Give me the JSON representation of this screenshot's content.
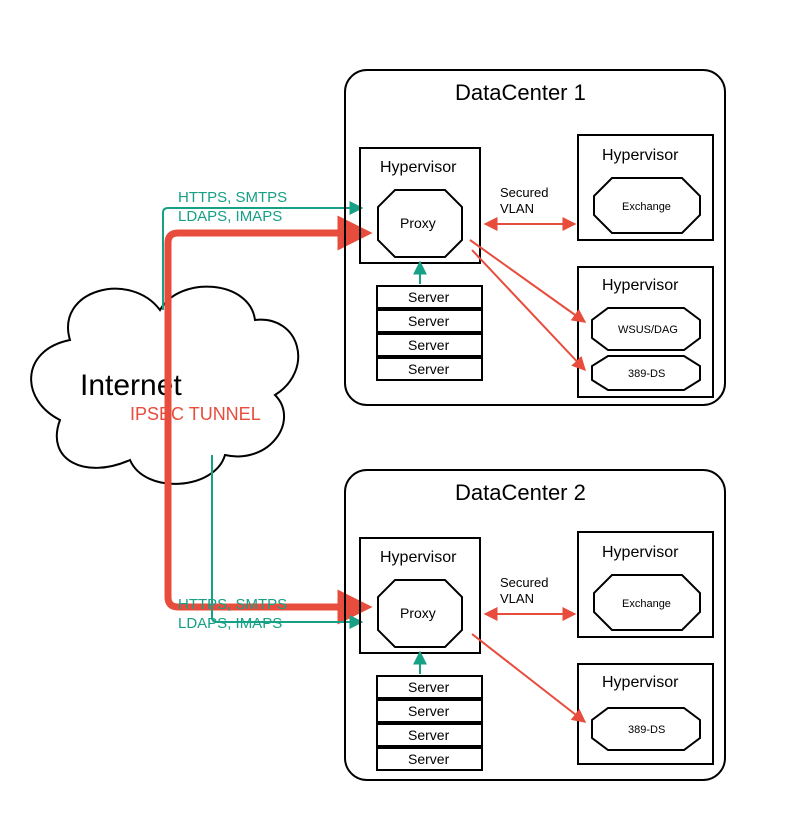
{
  "internet": {
    "label": "Internet"
  },
  "ipsec": {
    "label": "IPSEC TUNNEL"
  },
  "protocols": {
    "line1": "HTTPS, SMTPS",
    "line2": "LDAPS, IMAPS"
  },
  "secured_vlan": {
    "line1": "Secured",
    "line2": "VLAN"
  },
  "server_label": "Server",
  "dc1": {
    "title": "DataCenter 1",
    "hypervisor_label": "Hypervisor",
    "proxy_label": "Proxy",
    "hv_right_top": {
      "node": "Exchange"
    },
    "hv_right_bottom": {
      "node1": "WSUS/DAG",
      "node2": "389-DS"
    }
  },
  "dc2": {
    "title": "DataCenter 2",
    "hypervisor_label": "Hypervisor",
    "proxy_label": "Proxy",
    "hv_right_top": {
      "node": "Exchange"
    },
    "hv_right_bottom": {
      "node1": "389-DS"
    }
  }
}
